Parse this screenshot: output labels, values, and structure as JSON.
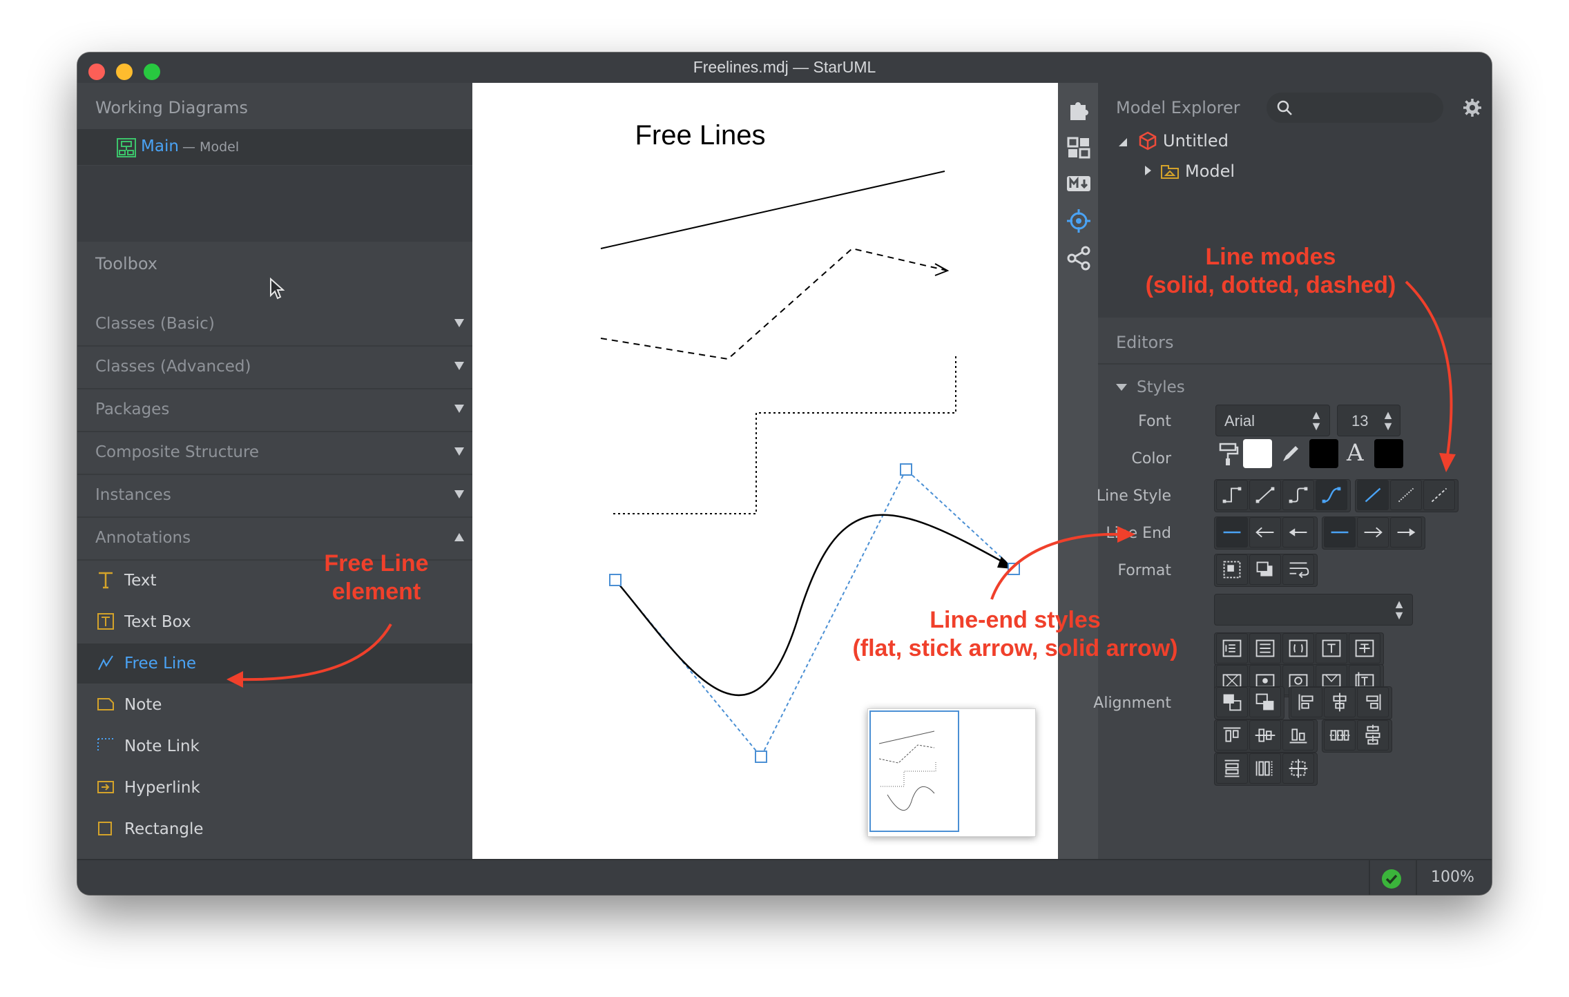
{
  "window": {
    "title": "Freelines.mdj — StarUML"
  },
  "working_diagrams": {
    "header": "Working Diagrams",
    "item_name": "Main",
    "item_sep": " — ",
    "item_type": "Model"
  },
  "toolbox": {
    "header": "Toolbox",
    "groups": [
      {
        "label": "Classes (Basic)",
        "state": "collapsed"
      },
      {
        "label": "Classes (Advanced)",
        "state": "collapsed"
      },
      {
        "label": "Packages",
        "state": "collapsed"
      },
      {
        "label": "Composite Structure",
        "state": "collapsed"
      },
      {
        "label": "Instances",
        "state": "collapsed"
      },
      {
        "label": "Annotations",
        "state": "expanded"
      }
    ],
    "tools": [
      {
        "label": "Text",
        "icon": "text-icon"
      },
      {
        "label": "Text Box",
        "icon": "text-box-icon"
      },
      {
        "label": "Free Line",
        "icon": "free-line-icon",
        "selected": true
      },
      {
        "label": "Note",
        "icon": "note-icon"
      },
      {
        "label": "Note Link",
        "icon": "note-link-icon"
      },
      {
        "label": "Hyperlink",
        "icon": "hyperlink-icon"
      },
      {
        "label": "Rectangle",
        "icon": "rectangle-icon"
      }
    ]
  },
  "diagram": {
    "title": "Free Lines"
  },
  "model_explorer": {
    "header": "Model Explorer",
    "search_placeholder": "",
    "tree": [
      {
        "label": "Untitled",
        "icon": "project-cube-icon",
        "expanded": true
      },
      {
        "label": "Model",
        "icon": "model-package-icon",
        "expanded": false
      }
    ]
  },
  "editors": {
    "header": "Editors",
    "styles_header": "Styles",
    "font_label": "Font",
    "font_value": "Arial",
    "font_size": "13",
    "color_label": "Color",
    "line_style_label": "Line Style",
    "line_end_label": "Line End",
    "format_label": "Format",
    "alignment_label": "Alignment",
    "colors": {
      "fill": "#ffffff",
      "line": "#000000",
      "font": "#000000"
    }
  },
  "status": {
    "zoom": "100%",
    "validation": "ok-check-icon"
  },
  "annotations": {
    "free_line_1": "Free Line",
    "free_line_2": "element",
    "line_modes_1": "Line modes",
    "line_modes_2": "(solid, dotted, dashed)",
    "line_end_1": "Line-end styles",
    "line_end_2": "(flat, stick arrow, solid arrow)"
  },
  "colors": {
    "accent": "#4aa3f5",
    "annotation": "#f0402b",
    "panel": "#414448"
  }
}
